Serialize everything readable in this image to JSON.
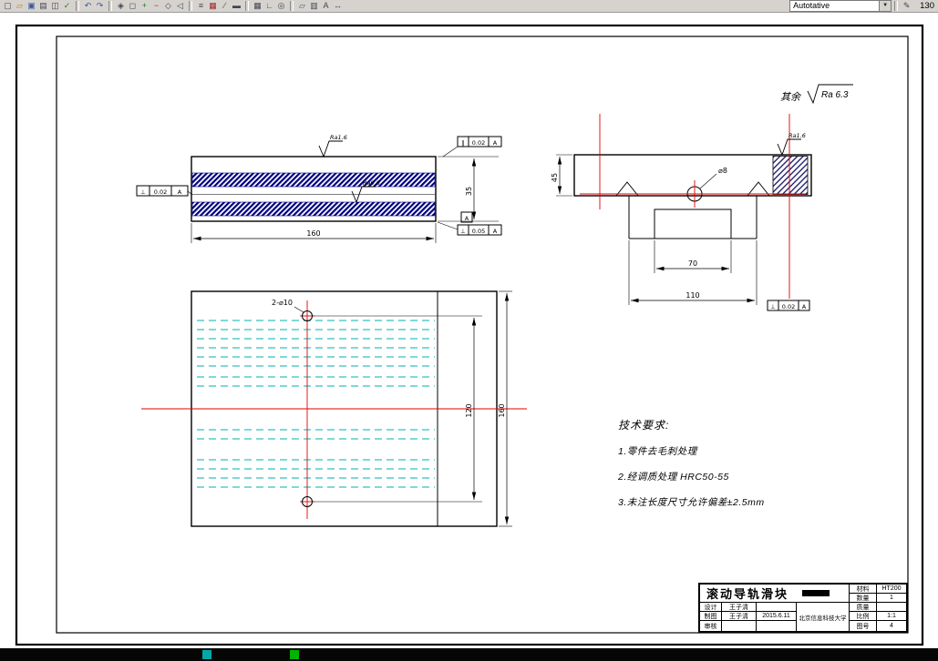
{
  "toolbar": {
    "icons": [
      {
        "name": "new-file-icon",
        "glyph": "▢",
        "color": "#445"
      },
      {
        "name": "open-folder-icon",
        "glyph": "▱",
        "color": "#b08800"
      },
      {
        "name": "save-icon",
        "glyph": "▣",
        "color": "#3a5a9a"
      },
      {
        "name": "print-icon",
        "glyph": "▤",
        "color": "#445"
      },
      {
        "name": "preview-icon",
        "glyph": "◫",
        "color": "#445"
      },
      {
        "name": "spellcheck-icon",
        "glyph": "✓",
        "color": "#2a7a2a"
      },
      {
        "name": "undo-icon",
        "glyph": "↶",
        "color": "#3a5a9a"
      },
      {
        "name": "redo-icon",
        "glyph": "↷",
        "color": "#3a5a9a"
      },
      {
        "name": "pan-icon",
        "glyph": "◈",
        "color": "#445"
      },
      {
        "name": "zoom-window-icon",
        "glyph": "◻",
        "color": "#445"
      },
      {
        "name": "zoom-in-icon",
        "glyph": "+",
        "color": "#2a7a2a"
      },
      {
        "name": "zoom-out-icon",
        "glyph": "−",
        "color": "#9a2a2a"
      },
      {
        "name": "zoom-extents-icon",
        "glyph": "◇",
        "color": "#445"
      },
      {
        "name": "zoom-previous-icon",
        "glyph": "◁",
        "color": "#445"
      },
      {
        "name": "layers-icon",
        "glyph": "≡",
        "color": "#445"
      },
      {
        "name": "layer-color-icon",
        "glyph": "▦",
        "color": "#9a2a2a"
      },
      {
        "name": "linetype-icon",
        "glyph": "∕",
        "color": "#445"
      },
      {
        "name": "lineweight-icon",
        "glyph": "▬",
        "color": "#445"
      },
      {
        "name": "grid-icon",
        "glyph": "▦",
        "color": "#445"
      },
      {
        "name": "ortho-icon",
        "glyph": "∟",
        "color": "#445"
      },
      {
        "name": "osnap-icon",
        "glyph": "◎",
        "color": "#445"
      },
      {
        "name": "blocks-icon",
        "glyph": "▱",
        "color": "#3a5a9a"
      },
      {
        "name": "table-icon",
        "glyph": "▥",
        "color": "#445"
      },
      {
        "name": "text-style-icon",
        "glyph": "A",
        "color": "#445"
      },
      {
        "name": "dim-style-icon",
        "glyph": "↔",
        "color": "#445"
      },
      {
        "name": "pen-icon",
        "glyph": "✎",
        "color": "#445"
      }
    ],
    "style_dropdown_value": "Autotative",
    "dropdown_arrow": "▼",
    "coord_display": "130"
  },
  "drawing": {
    "surface_note": {
      "prefix": "其余",
      "value": "Ra 6.3"
    },
    "tech_requirements": {
      "title": "技术要求:",
      "items": [
        "1.零件去毛刺处理",
        "2.经调质处理 HRC50-55",
        "3.未注长度尺寸允许偏差±2.5mm"
      ]
    },
    "side_view": {
      "dim_width": "160",
      "dim_height": "35",
      "rough_top": "Ra1.6",
      "rough_mid": "Ra0.8",
      "tol_left": {
        "sym": "⊥",
        "val": "0.02",
        "datum": "A"
      },
      "tol_top": {
        "sym": "∥",
        "val": "0.02",
        "datum": "A"
      },
      "tol_bottom": {
        "sym": "⊥",
        "val": "0.05",
        "datum": "A"
      },
      "datum_flag": "A"
    },
    "section_view": {
      "dim_inner": "70",
      "dim_outer": "110",
      "dim_height": "45",
      "hole_label": "⌀8",
      "rough": "Ra1.6",
      "tol_bottom": {
        "sym": "⊥",
        "val": "0.02",
        "datum": "A"
      }
    },
    "plan_view": {
      "hole_note": "2-⌀10",
      "dim_span": "120",
      "dim_total": "160"
    },
    "title_block": {
      "part_name": "滚动导轨滑块",
      "material_label": "材料",
      "material": "HT200",
      "qty_label": "数量",
      "qty": "1",
      "weight_label": "质量",
      "weight": "",
      "scale_label": "比例",
      "scale": "1:1",
      "no_label": "图号",
      "no": "4",
      "design_label": "设计",
      "design_name": "王子清",
      "draft_label": "制图",
      "draft_name": "王子清",
      "draft_date": "2015.6.11",
      "check_label": "审核",
      "org": "北京信息科技大学"
    },
    "colors": {
      "centerline": "#e10000",
      "hidden_line": "#00b2b2",
      "hatch": "#000080"
    }
  },
  "taskbar": {
    "icons": [
      {
        "name": "taskbar-app-1",
        "color": "#00a8a8"
      },
      {
        "name": "taskbar-app-2",
        "color": "#00b400"
      }
    ]
  }
}
